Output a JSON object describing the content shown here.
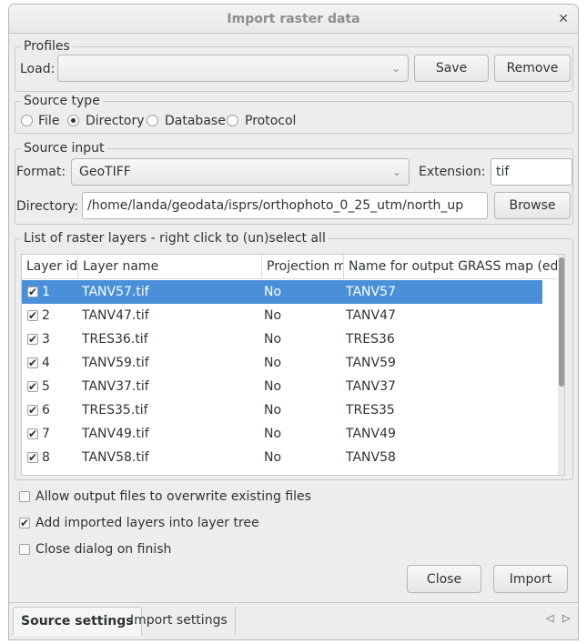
{
  "window": {
    "title": "Import raster data",
    "close_glyph": "✕"
  },
  "profiles": {
    "group_title": "Profiles",
    "load_label": "Load:",
    "load_value": "",
    "save_label": "Save",
    "remove_label": "Remove"
  },
  "source_type": {
    "group_title": "Source type",
    "options": [
      {
        "label": "File",
        "selected": false
      },
      {
        "label": "Directory",
        "selected": true
      },
      {
        "label": "Database",
        "selected": false
      },
      {
        "label": "Protocol",
        "selected": false
      }
    ]
  },
  "source_input": {
    "group_title": "Source input",
    "format_label": "Format:",
    "format_value": "GeoTIFF",
    "extension_label": "Extension:",
    "extension_value": "tif",
    "directory_label": "Directory:",
    "directory_value": "/home/landa/geodata/isprs/orthophoto_0_25_utm/north_up",
    "browse_label": "Browse"
  },
  "layers": {
    "group_title": "List of raster layers - right click to (un)select all",
    "columns": [
      "Layer id",
      "Layer name",
      "Projection ma",
      "Name for output GRASS map (ed"
    ],
    "rows": [
      {
        "id": "1",
        "name": "TANV57.tif",
        "projection": "No",
        "output": "TANV57",
        "checked": true,
        "selected": true
      },
      {
        "id": "2",
        "name": "TANV47.tif",
        "projection": "No",
        "output": "TANV47",
        "checked": true,
        "selected": false
      },
      {
        "id": "3",
        "name": "TRES36.tif",
        "projection": "No",
        "output": "TRES36",
        "checked": true,
        "selected": false
      },
      {
        "id": "4",
        "name": "TANV59.tif",
        "projection": "No",
        "output": "TANV59",
        "checked": true,
        "selected": false
      },
      {
        "id": "5",
        "name": "TANV37.tif",
        "projection": "No",
        "output": "TANV37",
        "checked": true,
        "selected": false
      },
      {
        "id": "6",
        "name": "TRES35.tif",
        "projection": "No",
        "output": "TRES35",
        "checked": true,
        "selected": false
      },
      {
        "id": "7",
        "name": "TANV49.tif",
        "projection": "No",
        "output": "TANV49",
        "checked": true,
        "selected": false
      },
      {
        "id": "8",
        "name": "TANV58.tif",
        "projection": "No",
        "output": "TANV58",
        "checked": true,
        "selected": false
      }
    ]
  },
  "options": [
    {
      "label": "Allow output files to overwrite existing files",
      "checked": false
    },
    {
      "label": "Add imported layers into layer tree",
      "checked": true
    },
    {
      "label": "Close dialog on finish",
      "checked": false
    }
  ],
  "actions": {
    "close_label": "Close",
    "import_label": "Import"
  },
  "tabs": [
    {
      "label": "Source settings",
      "active": true
    },
    {
      "label": "Import settings",
      "active": false
    }
  ],
  "colors": {
    "selection": "#4a90d9",
    "window_bg": "#ededed"
  },
  "icons": {
    "check": "✔",
    "chevron_down": "⌄",
    "arrow_left": "◁",
    "arrow_right": "▷"
  }
}
